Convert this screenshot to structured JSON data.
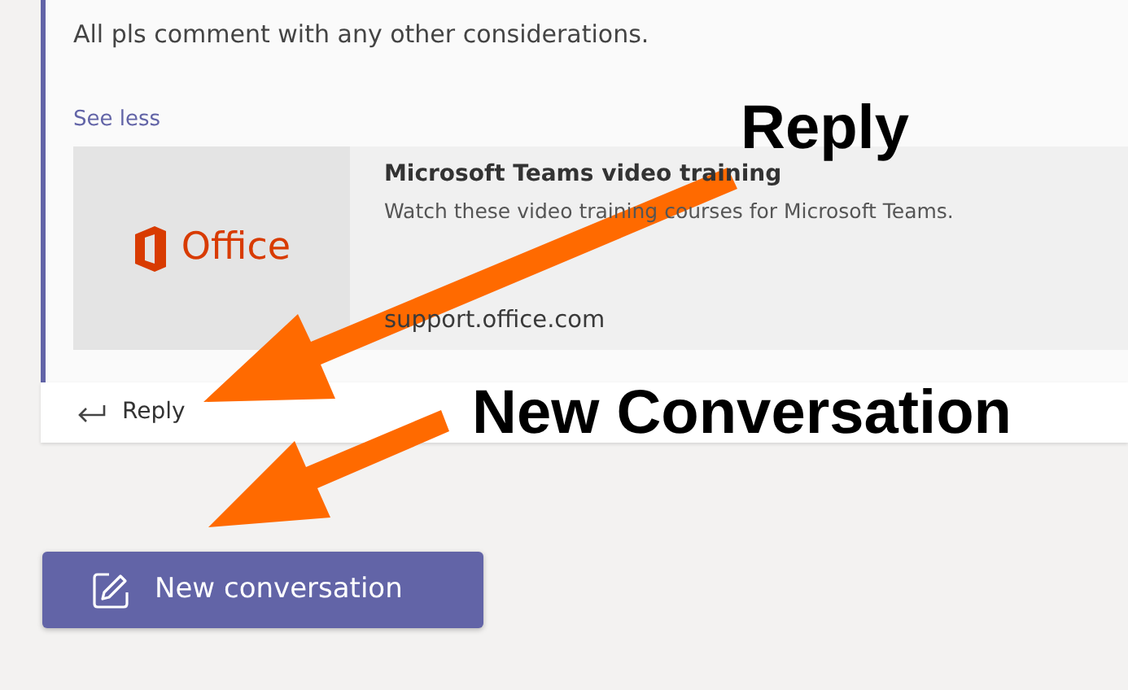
{
  "message": {
    "text": "All pls comment with any other considerations.",
    "toggle_link": "See less",
    "link_preview": {
      "logo_text": "Office",
      "title": "Microsoft Teams video training",
      "description": "Watch these video training courses for Microsoft Teams.",
      "url": "support.office.com"
    },
    "reply_label": "Reply"
  },
  "new_conversation_button": "New conversation",
  "annotations": [
    {
      "label": "Reply",
      "kind": "reply"
    },
    {
      "label": "New Conversation",
      "kind": "new"
    }
  ]
}
